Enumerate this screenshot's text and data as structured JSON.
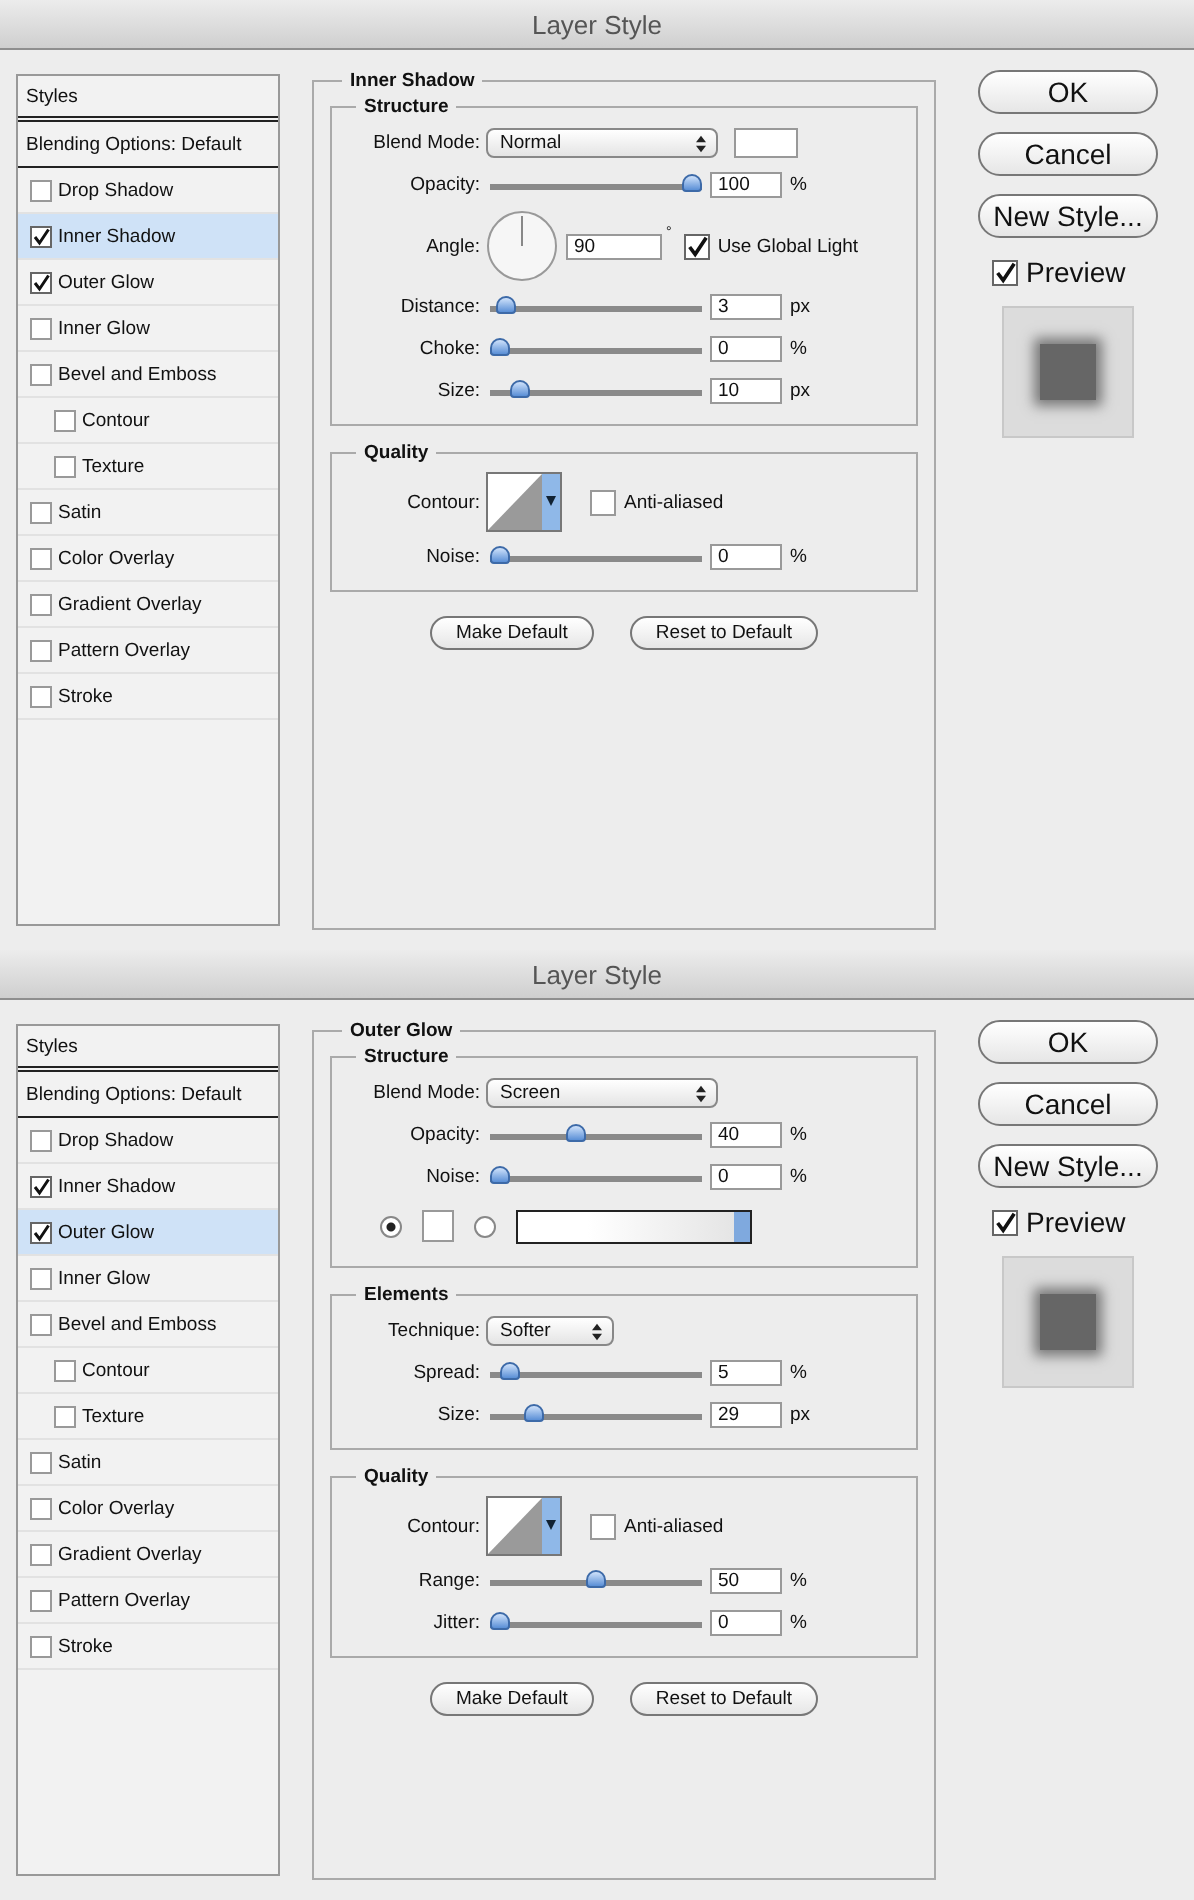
{
  "dialogs": [
    {
      "title": "Layer Style",
      "styles_header": "Styles",
      "blending_options": "Blending Options: Default",
      "style_items": [
        {
          "label": "Drop Shadow",
          "checked": false,
          "selected": false
        },
        {
          "label": "Inner Shadow",
          "checked": true,
          "selected": true
        },
        {
          "label": "Outer Glow",
          "checked": true,
          "selected": false
        },
        {
          "label": "Inner Glow",
          "checked": false,
          "selected": false
        },
        {
          "label": "Bevel and Emboss",
          "checked": false,
          "selected": false,
          "children": [
            {
              "label": "Contour",
              "checked": false,
              "selected": false
            },
            {
              "label": "Texture",
              "checked": false,
              "selected": false
            }
          ]
        },
        {
          "label": "Satin",
          "checked": false,
          "selected": false
        },
        {
          "label": "Color Overlay",
          "checked": false,
          "selected": false
        },
        {
          "label": "Gradient Overlay",
          "checked": false,
          "selected": false
        },
        {
          "label": "Pattern Overlay",
          "checked": false,
          "selected": false
        },
        {
          "label": "Stroke",
          "checked": false,
          "selected": false
        }
      ],
      "panel": {
        "title": "Inner Shadow",
        "groups": [
          {
            "title": "Structure",
            "rows": [
              {
                "kind": "select",
                "label": "Blend Mode:",
                "value": "Normal",
                "swatch": true
              },
              {
                "kind": "slider",
                "label": "Opacity:",
                "level": 1,
                "value": "100",
                "unit": "%"
              },
              {
                "kind": "angle",
                "label": "Angle:",
                "value": "90",
                "unit": "°",
                "checkbox": {
                  "label": "Use Global Light",
                  "checked": true
                }
              },
              {
                "kind": "slider",
                "label": "Distance:",
                "level": 0.03,
                "value": "3",
                "unit": "px"
              },
              {
                "kind": "slider",
                "label": "Choke:",
                "level": 0,
                "value": "0",
                "unit": "%"
              },
              {
                "kind": "slider",
                "label": "Size:",
                "level": 0.1,
                "value": "10",
                "unit": "px"
              }
            ]
          },
          {
            "title": "Quality",
            "rows": [
              {
                "kind": "contour",
                "label": "Contour:",
                "checkbox": {
                  "label": "Anti-aliased",
                  "checked": false
                }
              },
              {
                "kind": "slider",
                "label": "Noise:",
                "level": 0,
                "value": "0",
                "unit": "%"
              }
            ]
          }
        ],
        "buttons": [
          "Make Default",
          "Reset to Default"
        ]
      },
      "buttons": [
        "OK",
        "Cancel",
        "New Style..."
      ],
      "preview": {
        "label": "Preview",
        "checked": true
      }
    },
    {
      "title": "Layer Style",
      "styles_header": "Styles",
      "blending_options": "Blending Options: Default",
      "style_items": [
        {
          "label": "Drop Shadow",
          "checked": false,
          "selected": false
        },
        {
          "label": "Inner Shadow",
          "checked": true,
          "selected": false
        },
        {
          "label": "Outer Glow",
          "checked": true,
          "selected": true
        },
        {
          "label": "Inner Glow",
          "checked": false,
          "selected": false
        },
        {
          "label": "Bevel and Emboss",
          "checked": false,
          "selected": false,
          "children": [
            {
              "label": "Contour",
              "checked": false,
              "selected": false
            },
            {
              "label": "Texture",
              "checked": false,
              "selected": false
            }
          ]
        },
        {
          "label": "Satin",
          "checked": false,
          "selected": false
        },
        {
          "label": "Color Overlay",
          "checked": false,
          "selected": false
        },
        {
          "label": "Gradient Overlay",
          "checked": false,
          "selected": false
        },
        {
          "label": "Pattern Overlay",
          "checked": false,
          "selected": false
        },
        {
          "label": "Stroke",
          "checked": false,
          "selected": false
        }
      ],
      "panel": {
        "title": "Outer Glow",
        "groups": [
          {
            "title": "Structure",
            "rows": [
              {
                "kind": "select",
                "label": "Blend Mode:",
                "value": "Screen",
                "swatch": false
              },
              {
                "kind": "slider",
                "label": "Opacity:",
                "level": 0.4,
                "value": "40",
                "unit": "%"
              },
              {
                "kind": "slider",
                "label": "Noise:",
                "level": 0,
                "value": "0",
                "unit": "%"
              },
              {
                "kind": "fill",
                "options": [
                  {
                    "selected": true
                  },
                  {
                    "selected": false
                  }
                ]
              }
            ]
          },
          {
            "title": "Elements",
            "rows": [
              {
                "kind": "select",
                "label": "Technique:",
                "value": "Softer",
                "swatch": false,
                "narrow": true
              },
              {
                "kind": "slider",
                "label": "Spread:",
                "level": 0.05,
                "value": "5",
                "unit": "%"
              },
              {
                "kind": "slider",
                "label": "Size:",
                "level": 0.18,
                "value": "29",
                "unit": "px"
              }
            ]
          },
          {
            "title": "Quality",
            "rows": [
              {
                "kind": "contour",
                "label": "Contour:",
                "checkbox": {
                  "label": "Anti-aliased",
                  "checked": false
                }
              },
              {
                "kind": "slider",
                "label": "Range:",
                "level": 0.5,
                "value": "50",
                "unit": "%"
              },
              {
                "kind": "slider",
                "label": "Jitter:",
                "level": 0,
                "value": "0",
                "unit": "%"
              }
            ]
          }
        ],
        "buttons": [
          "Make Default",
          "Reset to Default"
        ]
      },
      "buttons": [
        "OK",
        "Cancel",
        "New Style..."
      ],
      "preview": {
        "label": "Preview",
        "checked": true
      }
    }
  ]
}
